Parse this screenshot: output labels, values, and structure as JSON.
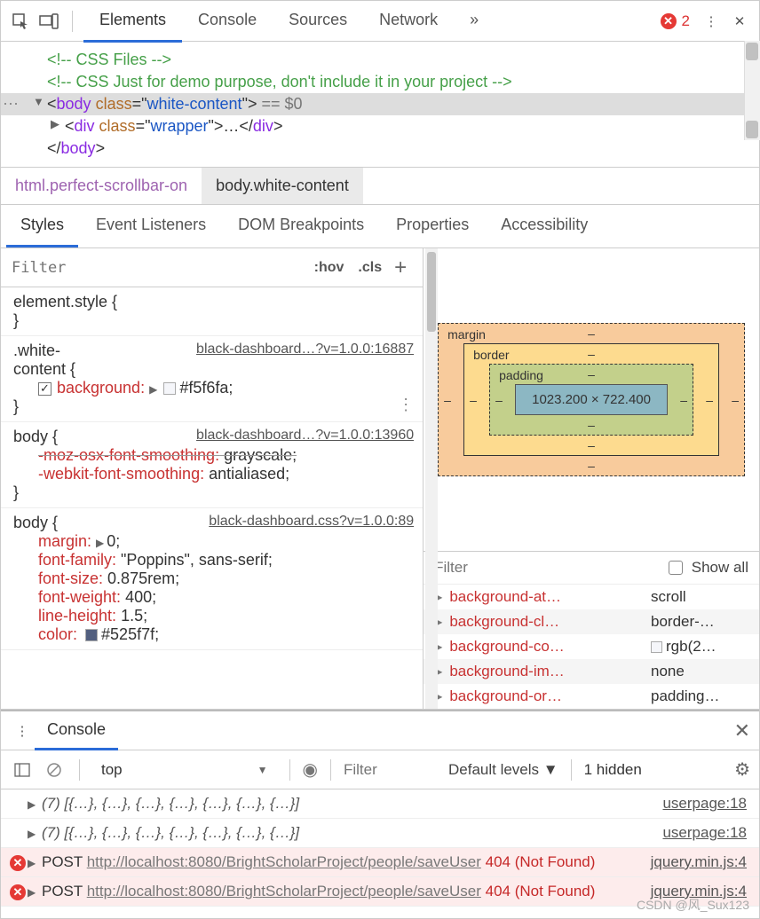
{
  "toolbar": {
    "tabs": [
      "Elements",
      "Console",
      "Sources",
      "Network"
    ],
    "active_tab": 0,
    "error_count": "2"
  },
  "dom": {
    "lines": [
      {
        "html": "<span class='cmt'>&lt;!-- CSS Files --&gt;</span>"
      },
      {
        "html": "<span class='cmt'>&lt;!-- CSS Just for demo purpose, don't include it in your project --&gt;</span>"
      },
      {
        "html": "<span class='dots'>⋯</span><span class='arr'>▼</span>&lt;<span class='tg'>body</span> <span class='at'>class</span>=\"<span class='vl'>white-content</span>\"&gt;<span class='eq'> == $0</span>",
        "sel": true
      },
      {
        "html": "<span class='arr'>▶</span>&lt;<span class='tg'>div</span> <span class='at'>class</span>=\"<span class='vl'>wrapper</span>\"&gt;…&lt;/<span class='tg'>div</span>&gt;",
        "indent": 72
      },
      {
        "html": "&lt;/<span class='tg'>body</span>&gt;"
      }
    ]
  },
  "crumbs": [
    "html.perfect-scrollbar-on",
    "body.white-content"
  ],
  "subtabs": [
    "Styles",
    "Event Listeners",
    "DOM Breakpoints",
    "Properties",
    "Accessibility"
  ],
  "styles": {
    "filter_placeholder": "Filter",
    "hov": ":hov",
    "cls": ".cls",
    "rules": [
      {
        "selector": "element.style {",
        "close": "}",
        "props": []
      },
      {
        "selector": ".white-content {",
        "source": "black-dashboard…?v=1.0.0:16887",
        "close": "}",
        "kebab": true,
        "props": [
          {
            "checked": true,
            "name": "background:",
            "tri": true,
            "swatch": "#f5f6fa",
            "value": "#f5f6fa;"
          }
        ],
        "wrap_selector": true,
        "sel2": ".white-",
        "sel3": "content {"
      },
      {
        "selector": "body {",
        "source": "black-dashboard…?v=1.0.0:13960",
        "close": "}",
        "props": [
          {
            "strike": true,
            "name": "-moz-osx-font-smoothing:",
            "value": "grayscale;"
          },
          {
            "name": "-webkit-font-smoothing:",
            "value": "antialiased;"
          }
        ]
      },
      {
        "selector": "body {",
        "source": "black-dashboard.css?v=1.0.0:89",
        "props": [
          {
            "name": "margin:",
            "tri": true,
            "value": "0;"
          },
          {
            "name": "font-family:",
            "value": "\"Poppins\", sans-serif;"
          },
          {
            "name": "font-size:",
            "value": "0.875rem;"
          },
          {
            "name": "font-weight:",
            "value": "400;"
          },
          {
            "name": "line-height:",
            "value": "1.5;"
          },
          {
            "name": "color:",
            "swatch": "#525f7f",
            "value": "#525f7f;",
            "cut": true
          }
        ]
      }
    ]
  },
  "boxmodel": {
    "margin": "margin",
    "border": "border",
    "padding": "padding",
    "content": "1023.200 × 722.400",
    "dash": "–"
  },
  "computed": {
    "filter_placeholder": "Filter",
    "show_all": "Show all",
    "rows": [
      {
        "n": "background-at…",
        "v": "scroll"
      },
      {
        "n": "background-cl…",
        "v": "border-…"
      },
      {
        "n": "background-co…",
        "v": "rgb(2…",
        "sw": "#f5f6fa"
      },
      {
        "n": "background-im…",
        "v": "none"
      },
      {
        "n": "background-or…",
        "v": "padding…"
      }
    ]
  },
  "drawer": {
    "title": "Console",
    "context": "top",
    "filter_placeholder": "Filter",
    "levels": "Default levels",
    "hidden": "1 hidden",
    "logs": [
      {
        "type": "log",
        "text": "(7) [{…}, {…}, {…}, {…}, {…}, {…}, {…}]",
        "src": "userpage:18"
      },
      {
        "type": "log",
        "text": "(7) [{…}, {…}, {…}, {…}, {…}, {…}, {…}]",
        "src": "userpage:18"
      },
      {
        "type": "err",
        "method": "POST",
        "url": "http://localhost:8080/BrightScholarProject/people/saveUser",
        "status": "404 (Not Found)",
        "src": "jquery.min.js:4"
      },
      {
        "type": "err",
        "method": "POST",
        "url": "http://localhost:8080/BrightScholarProject/people/saveUser",
        "status": "404 (Not Found)",
        "src": "jquery.min.js:4"
      }
    ]
  },
  "watermark": "CSDN @风_Sux123"
}
